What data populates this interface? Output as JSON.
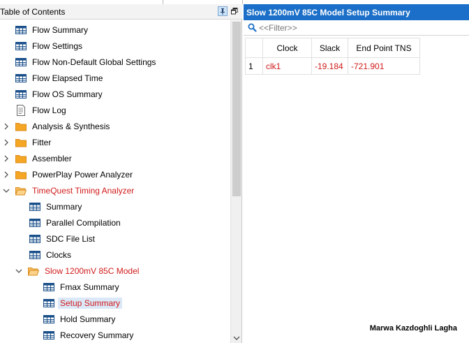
{
  "left_panel": {
    "title": "Table of Contents"
  },
  "tree": [
    {
      "label": "Flow Summary",
      "icon": "table-icon",
      "indent": 1,
      "expander": "none",
      "style": "normal"
    },
    {
      "label": "Flow Settings",
      "icon": "table-icon",
      "indent": 1,
      "expander": "none",
      "style": "normal"
    },
    {
      "label": "Flow Non-Default Global Settings",
      "icon": "table-icon",
      "indent": 1,
      "expander": "none",
      "style": "normal"
    },
    {
      "label": "Flow Elapsed Time",
      "icon": "table-icon",
      "indent": 1,
      "expander": "none",
      "style": "normal"
    },
    {
      "label": "Flow OS Summary",
      "icon": "table-icon",
      "indent": 1,
      "expander": "none",
      "style": "normal"
    },
    {
      "label": "Flow Log",
      "icon": "document-icon",
      "indent": 1,
      "expander": "none",
      "style": "normal"
    },
    {
      "label": "Analysis & Synthesis",
      "icon": "folder-icon",
      "indent": 1,
      "expander": "collapsed",
      "style": "normal"
    },
    {
      "label": "Fitter",
      "icon": "folder-icon",
      "indent": 1,
      "expander": "collapsed",
      "style": "normal"
    },
    {
      "label": "Assembler",
      "icon": "folder-icon",
      "indent": 1,
      "expander": "collapsed",
      "style": "normal"
    },
    {
      "label": "PowerPlay Power Analyzer",
      "icon": "folder-icon",
      "indent": 1,
      "expander": "collapsed",
      "style": "normal"
    },
    {
      "label": "TimeQuest Timing Analyzer",
      "icon": "folder-open-icon",
      "indent": 1,
      "expander": "expanded",
      "style": "red"
    },
    {
      "label": "Summary",
      "icon": "table-icon",
      "indent": 2,
      "expander": "none",
      "style": "normal"
    },
    {
      "label": "Parallel Compilation",
      "icon": "table-icon",
      "indent": 2,
      "expander": "none",
      "style": "normal"
    },
    {
      "label": "SDC File List",
      "icon": "table-icon",
      "indent": 2,
      "expander": "none",
      "style": "normal"
    },
    {
      "label": "Clocks",
      "icon": "table-icon",
      "indent": 2,
      "expander": "none",
      "style": "normal"
    },
    {
      "label": "Slow 1200mV 85C Model",
      "icon": "folder-open-icon",
      "indent": 2,
      "expander": "expanded",
      "style": "red"
    },
    {
      "label": "Fmax Summary",
      "icon": "table-icon",
      "indent": 3,
      "expander": "none",
      "style": "normal"
    },
    {
      "label": "Setup Summary",
      "icon": "table-icon",
      "indent": 3,
      "expander": "none",
      "style": "selected"
    },
    {
      "label": "Hold Summary",
      "icon": "table-icon",
      "indent": 3,
      "expander": "none",
      "style": "normal"
    },
    {
      "label": "Recovery Summary",
      "icon": "table-icon",
      "indent": 3,
      "expander": "none",
      "style": "normal"
    }
  ],
  "right_panel": {
    "title": "Slow 1200mV 85C Model Setup Summary",
    "filter_placeholder": "<<Filter>>",
    "table": {
      "headers": [
        "",
        "Clock",
        "Slack",
        "End Point TNS"
      ],
      "rows": [
        [
          "1",
          "clk1",
          "-19.184",
          "-721.901"
        ]
      ]
    }
  },
  "signature": "Marwa Kazdoghli Lagha",
  "colors": {
    "title_bar": "#1b6fc8",
    "red_text": "#d11a1a",
    "selection": "#dbe8f7",
    "folder": "#f5a623"
  }
}
